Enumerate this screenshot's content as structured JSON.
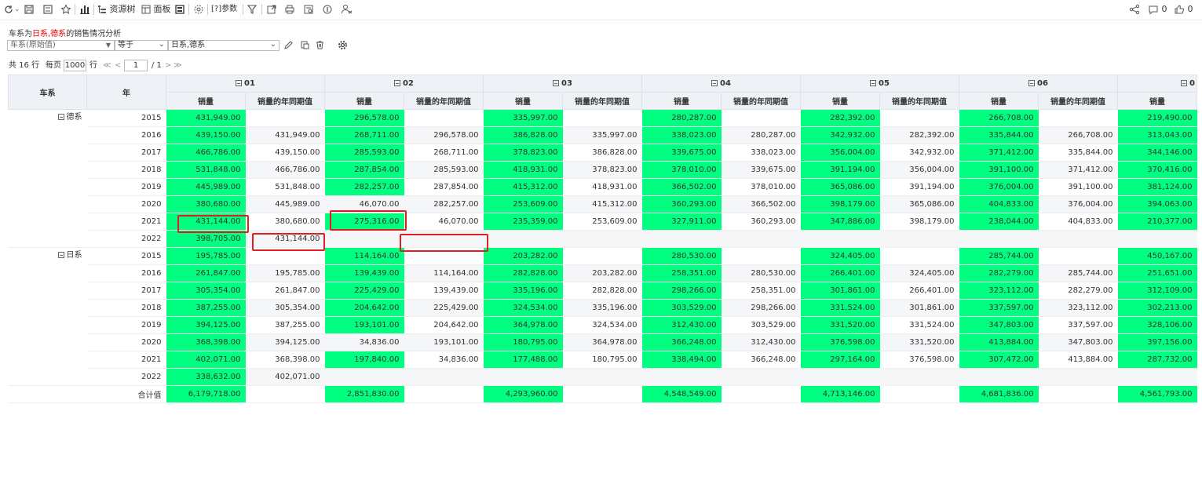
{
  "toolbar": {
    "resource_tree": "资源树",
    "panel": "面板",
    "params": "[?]参数",
    "comment_count": "0",
    "like_count": "0"
  },
  "filter": {
    "title_prefix": "车系为",
    "title_highlight": "日系,德系",
    "title_suffix": "的销售情况分析",
    "field": "车系(原始值)",
    "operator": "等于",
    "value": "日系,德系"
  },
  "pager": {
    "total": "共 16 行",
    "per_page_label": "每页",
    "per_page": "1000",
    "per_page_unit": "行",
    "first": "≪",
    "prev": "<",
    "page": "1",
    "total_pages": "/ 1",
    "next": ">",
    "last": "≫"
  },
  "table": {
    "col_series": "车系",
    "col_year": "年",
    "months": [
      "01",
      "02",
      "03",
      "04",
      "05",
      "06",
      "0"
    ],
    "measure_sales": "销量",
    "measure_yoy": "销量的年同期值",
    "colors": {
      "highlight": "#00ff80",
      "header_bg": "#eef1f5",
      "red_mark": "#e02020"
    },
    "groups": [
      {
        "name": "德系",
        "rows": [
          {
            "year": "2015",
            "cells": [
              "431,949.00",
              "",
              "296,578.00",
              "",
              "335,997.00",
              "",
              "280,287.00",
              "",
              "282,392.00",
              "",
              "266,708.00",
              "",
              "219,490.00"
            ]
          },
          {
            "year": "2016",
            "cells": [
              "439,150.00",
              "431,949.00",
              "268,711.00",
              "296,578.00",
              "386,828.00",
              "335,997.00",
              "338,023.00",
              "280,287.00",
              "342,932.00",
              "282,392.00",
              "335,844.00",
              "266,708.00",
              "313,043.00"
            ]
          },
          {
            "year": "2017",
            "cells": [
              "466,786.00",
              "439,150.00",
              "285,593.00",
              "268,711.00",
              "378,823.00",
              "386,828.00",
              "339,675.00",
              "338,023.00",
              "356,004.00",
              "342,932.00",
              "371,412.00",
              "335,844.00",
              "344,146.00"
            ]
          },
          {
            "year": "2018",
            "cells": [
              "531,848.00",
              "466,786.00",
              "287,854.00",
              "285,593.00",
              "418,931.00",
              "378,823.00",
              "378,010.00",
              "339,675.00",
              "391,194.00",
              "356,004.00",
              "391,100.00",
              "371,412.00",
              "370,416.00"
            ]
          },
          {
            "year": "2019",
            "cells": [
              "445,989.00",
              "531,848.00",
              "282,257.00",
              "287,854.00",
              "415,312.00",
              "418,931.00",
              "366,502.00",
              "378,010.00",
              "365,086.00",
              "391,194.00",
              "376,004.00",
              "391,100.00",
              "381,124.00"
            ]
          },
          {
            "year": "2020",
            "cells": [
              "380,680.00",
              "445,989.00",
              "46,070.00",
              "282,257.00",
              "253,609.00",
              "415,312.00",
              "360,293.00",
              "366,502.00",
              "398,179.00",
              "365,086.00",
              "404,833.00",
              "376,004.00",
              "394,063.00"
            ]
          },
          {
            "year": "2021",
            "cells": [
              "431,144.00",
              "380,680.00",
              "275,316.00",
              "46,070.00",
              "235,359.00",
              "253,609.00",
              "327,911.00",
              "360,293.00",
              "347,886.00",
              "398,179.00",
              "238,044.00",
              "404,833.00",
              "210,377.00"
            ]
          },
          {
            "year": "2022",
            "cells": [
              "398,705.00",
              "431,144.00",
              "",
              "",
              "",
              "",
              "",
              "",
              "",
              "",
              "",
              "",
              ""
            ]
          }
        ]
      },
      {
        "name": "日系",
        "rows": [
          {
            "year": "2015",
            "cells": [
              "195,785.00",
              "",
              "114,164.00",
              "",
              "203,282.00",
              "",
              "280,530.00",
              "",
              "324,405.00",
              "",
              "285,744.00",
              "",
              "450,167.00"
            ]
          },
          {
            "year": "2016",
            "cells": [
              "261,847.00",
              "195,785.00",
              "139,439.00",
              "114,164.00",
              "282,828.00",
              "203,282.00",
              "258,351.00",
              "280,530.00",
              "266,401.00",
              "324,405.00",
              "282,279.00",
              "285,744.00",
              "251,651.00"
            ]
          },
          {
            "year": "2017",
            "cells": [
              "305,354.00",
              "261,847.00",
              "225,429.00",
              "139,439.00",
              "335,196.00",
              "282,828.00",
              "298,266.00",
              "258,351.00",
              "301,861.00",
              "266,401.00",
              "323,112.00",
              "282,279.00",
              "312,109.00"
            ]
          },
          {
            "year": "2018",
            "cells": [
              "387,255.00",
              "305,354.00",
              "204,642.00",
              "225,429.00",
              "324,534.00",
              "335,196.00",
              "303,529.00",
              "298,266.00",
              "331,524.00",
              "301,861.00",
              "337,597.00",
              "323,112.00",
              "302,213.00"
            ]
          },
          {
            "year": "2019",
            "cells": [
              "394,125.00",
              "387,255.00",
              "193,101.00",
              "204,642.00",
              "364,978.00",
              "324,534.00",
              "312,430.00",
              "303,529.00",
              "331,520.00",
              "331,524.00",
              "347,803.00",
              "337,597.00",
              "328,106.00"
            ]
          },
          {
            "year": "2020",
            "cells": [
              "368,398.00",
              "394,125.00",
              "34,836.00",
              "193,101.00",
              "180,795.00",
              "364,978.00",
              "366,248.00",
              "312,430.00",
              "376,598.00",
              "331,520.00",
              "413,884.00",
              "347,803.00",
              "397,156.00"
            ]
          },
          {
            "year": "2021",
            "cells": [
              "402,071.00",
              "368,398.00",
              "197,840.00",
              "34,836.00",
              "177,488.00",
              "180,795.00",
              "338,494.00",
              "366,248.00",
              "297,164.00",
              "376,598.00",
              "307,472.00",
              "413,884.00",
              "287,732.00"
            ]
          },
          {
            "year": "2022",
            "cells": [
              "338,632.00",
              "402,071.00",
              "",
              "",
              "",
              "",
              "",
              "",
              "",
              "",
              "",
              "",
              ""
            ]
          }
        ]
      }
    ],
    "total": {
      "label": "合计值",
      "cells": [
        "6,179,718.00",
        "",
        "2,851,830.00",
        "",
        "4,293,960.00",
        "",
        "4,548,549.00",
        "",
        "4,713,146.00",
        "",
        "4,681,836.00",
        "",
        "4,561,793.00"
      ]
    },
    "green_cells": {
      "德系": {
        "2015": [
          0,
          2,
          4,
          6,
          8,
          10,
          12
        ],
        "2016": [
          0,
          2,
          4,
          6,
          8,
          10,
          12
        ],
        "2017": [
          0,
          2,
          4,
          6,
          8,
          10,
          12
        ],
        "2018": [
          0,
          2,
          4,
          6,
          8,
          10,
          12
        ],
        "2019": [
          0,
          2,
          4,
          6,
          8,
          10,
          12
        ],
        "2020": [
          0,
          4,
          6,
          8,
          10,
          12
        ],
        "2021": [
          0,
          2,
          4,
          6,
          8,
          10,
          12
        ],
        "2022": [
          0
        ]
      },
      "日系": {
        "2015": [
          0,
          2,
          4,
          6,
          8,
          10,
          12
        ],
        "2016": [
          0,
          2,
          4,
          6,
          8,
          10,
          12
        ],
        "2017": [
          0,
          2,
          4,
          6,
          8,
          10,
          12
        ],
        "2018": [
          0,
          2,
          4,
          6,
          8,
          10,
          12
        ],
        "2019": [
          0,
          2,
          4,
          6,
          8,
          10,
          12
        ],
        "2020": [
          0,
          4,
          6,
          8,
          10,
          12
        ],
        "2021": [
          0,
          2,
          4,
          6,
          8,
          10,
          12
        ],
        "2022": [
          0
        ]
      },
      "total": [
        0,
        2,
        4,
        6,
        8,
        10,
        12
      ]
    }
  }
}
